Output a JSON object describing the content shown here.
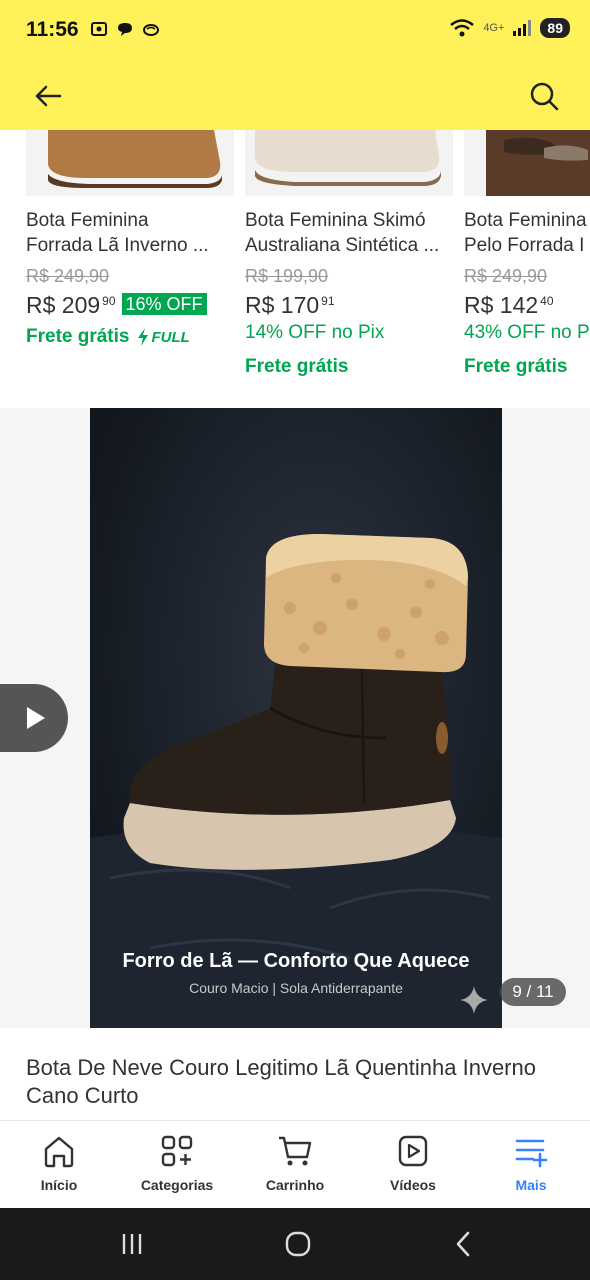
{
  "status_bar": {
    "time": "11:56",
    "network": "4G+",
    "battery": "89"
  },
  "header": {
    "icons": [
      "back-arrow-icon",
      "search-icon"
    ],
    "background": "#fff159"
  },
  "products": [
    {
      "title_line1": "Bota Feminina",
      "title_line2": "Forrada Lã Inverno ...",
      "old_price": "R$ 249,90",
      "price_main": "R$ 209",
      "price_cents": "90",
      "discount": "16% OFF",
      "shipping": "Frete grátis",
      "full_label": "FULL"
    },
    {
      "title_line1": "Bota Feminina Skimó",
      "title_line2": "Australiana Sintética ...",
      "old_price": "R$ 199,90",
      "price_main": "R$ 170",
      "price_cents": "91",
      "pix": "14% OFF no Pix",
      "shipping": "Frete grátis"
    },
    {
      "title_line1": "Bota Feminina",
      "title_line2": "Pelo Forrada I",
      "old_price": "R$ 249,90",
      "price_main": "R$ 142",
      "price_cents": "40",
      "pix": "43% OFF no P",
      "shipping": "Frete grátis"
    }
  ],
  "video": {
    "caption_title": "Forro de Lã — Conforto Que Aquece",
    "caption_sub": "Couro Macio | Sola Antiderrapante",
    "counter": "9 / 11"
  },
  "product_title": "Bota De Neve Couro Legitimo Lã Quentinha Inverno Cano Curto",
  "bottom_nav": [
    {
      "label": "Início",
      "icon": "home-icon"
    },
    {
      "label": "Categorias",
      "icon": "categories-icon"
    },
    {
      "label": "Carrinho",
      "icon": "cart-icon"
    },
    {
      "label": "Vídeos",
      "icon": "video-icon"
    },
    {
      "label": "Mais",
      "icon": "more-icon",
      "active": true
    }
  ],
  "colors": {
    "accent": "#3483fa",
    "green": "#00a650"
  }
}
